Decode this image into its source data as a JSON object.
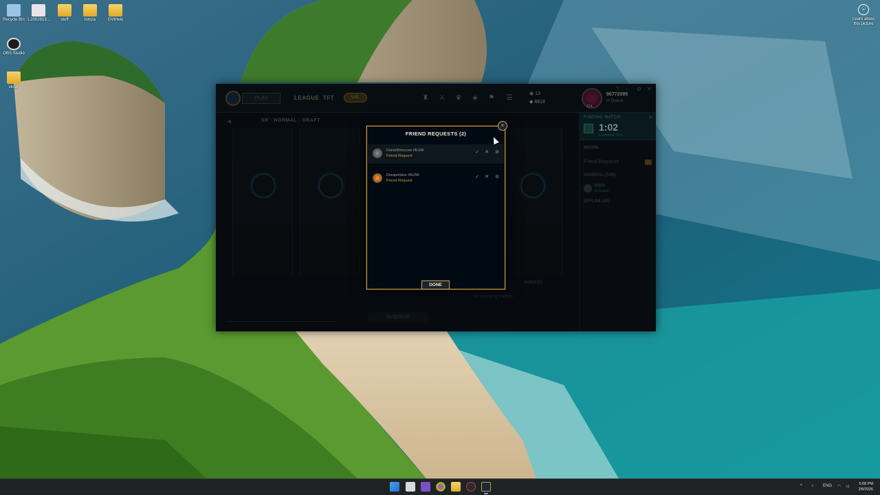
{
  "desktop": {
    "icons": [
      {
        "label": "Recycle Bin"
      },
      {
        "label": "1.2002813..."
      },
      {
        "label": "stuff"
      },
      {
        "label": "lomza"
      },
      {
        "label": "GVtHelo"
      },
      {
        "label": "OBS Studio"
      },
      {
        "label": "victor"
      }
    ],
    "learn_about": "Learn about this picture"
  },
  "client": {
    "nav": {
      "play": "PLAY",
      "league": "LEAGUE",
      "tft": "TFT",
      "lol_pill": "LoL"
    },
    "currency": {
      "rp": "13",
      "be": "6818"
    },
    "summoner": {
      "name": "96772095",
      "status": "In Queue",
      "level": "214"
    },
    "lobby": {
      "title": "SR · NORMAL · DRAFT",
      "invited": "Invited (0)",
      "no_pending": "No pending invites",
      "lock_label": "IN QUEUE"
    },
    "social": {
      "finding_label": "FINDING MATCH",
      "timer": "1:02",
      "estimated": "Estimated: 3:32",
      "title": "SOCIAL",
      "friend_requests": "Friend Requests",
      "general_group": "GENERAL (1/46)",
      "offline_group": "OFFLINE (45)",
      "friend_name": "tylyzu",
      "friend_status": "In Queue"
    }
  },
  "modal": {
    "title": "FRIEND REQUESTS (2)",
    "requests": [
      {
        "name": "DanteWreccow #EUW",
        "type": "Friend Request"
      },
      {
        "name": "Duraporlave #EUW",
        "type": "Friend Request"
      }
    ],
    "accept_symbol": "✓",
    "decline_symbol": "✕",
    "block_symbol": "⊘",
    "close_symbol": "×",
    "done_label": "DONE"
  },
  "taskbar": {
    "language": "ENG",
    "time": "5:08 PM",
    "date": "2/8/2026"
  },
  "colors": {
    "gold": "#c89b3c",
    "gold_light": "#f0e6d2",
    "modal_bg": "#010a13",
    "teal": "#2f7f82"
  }
}
